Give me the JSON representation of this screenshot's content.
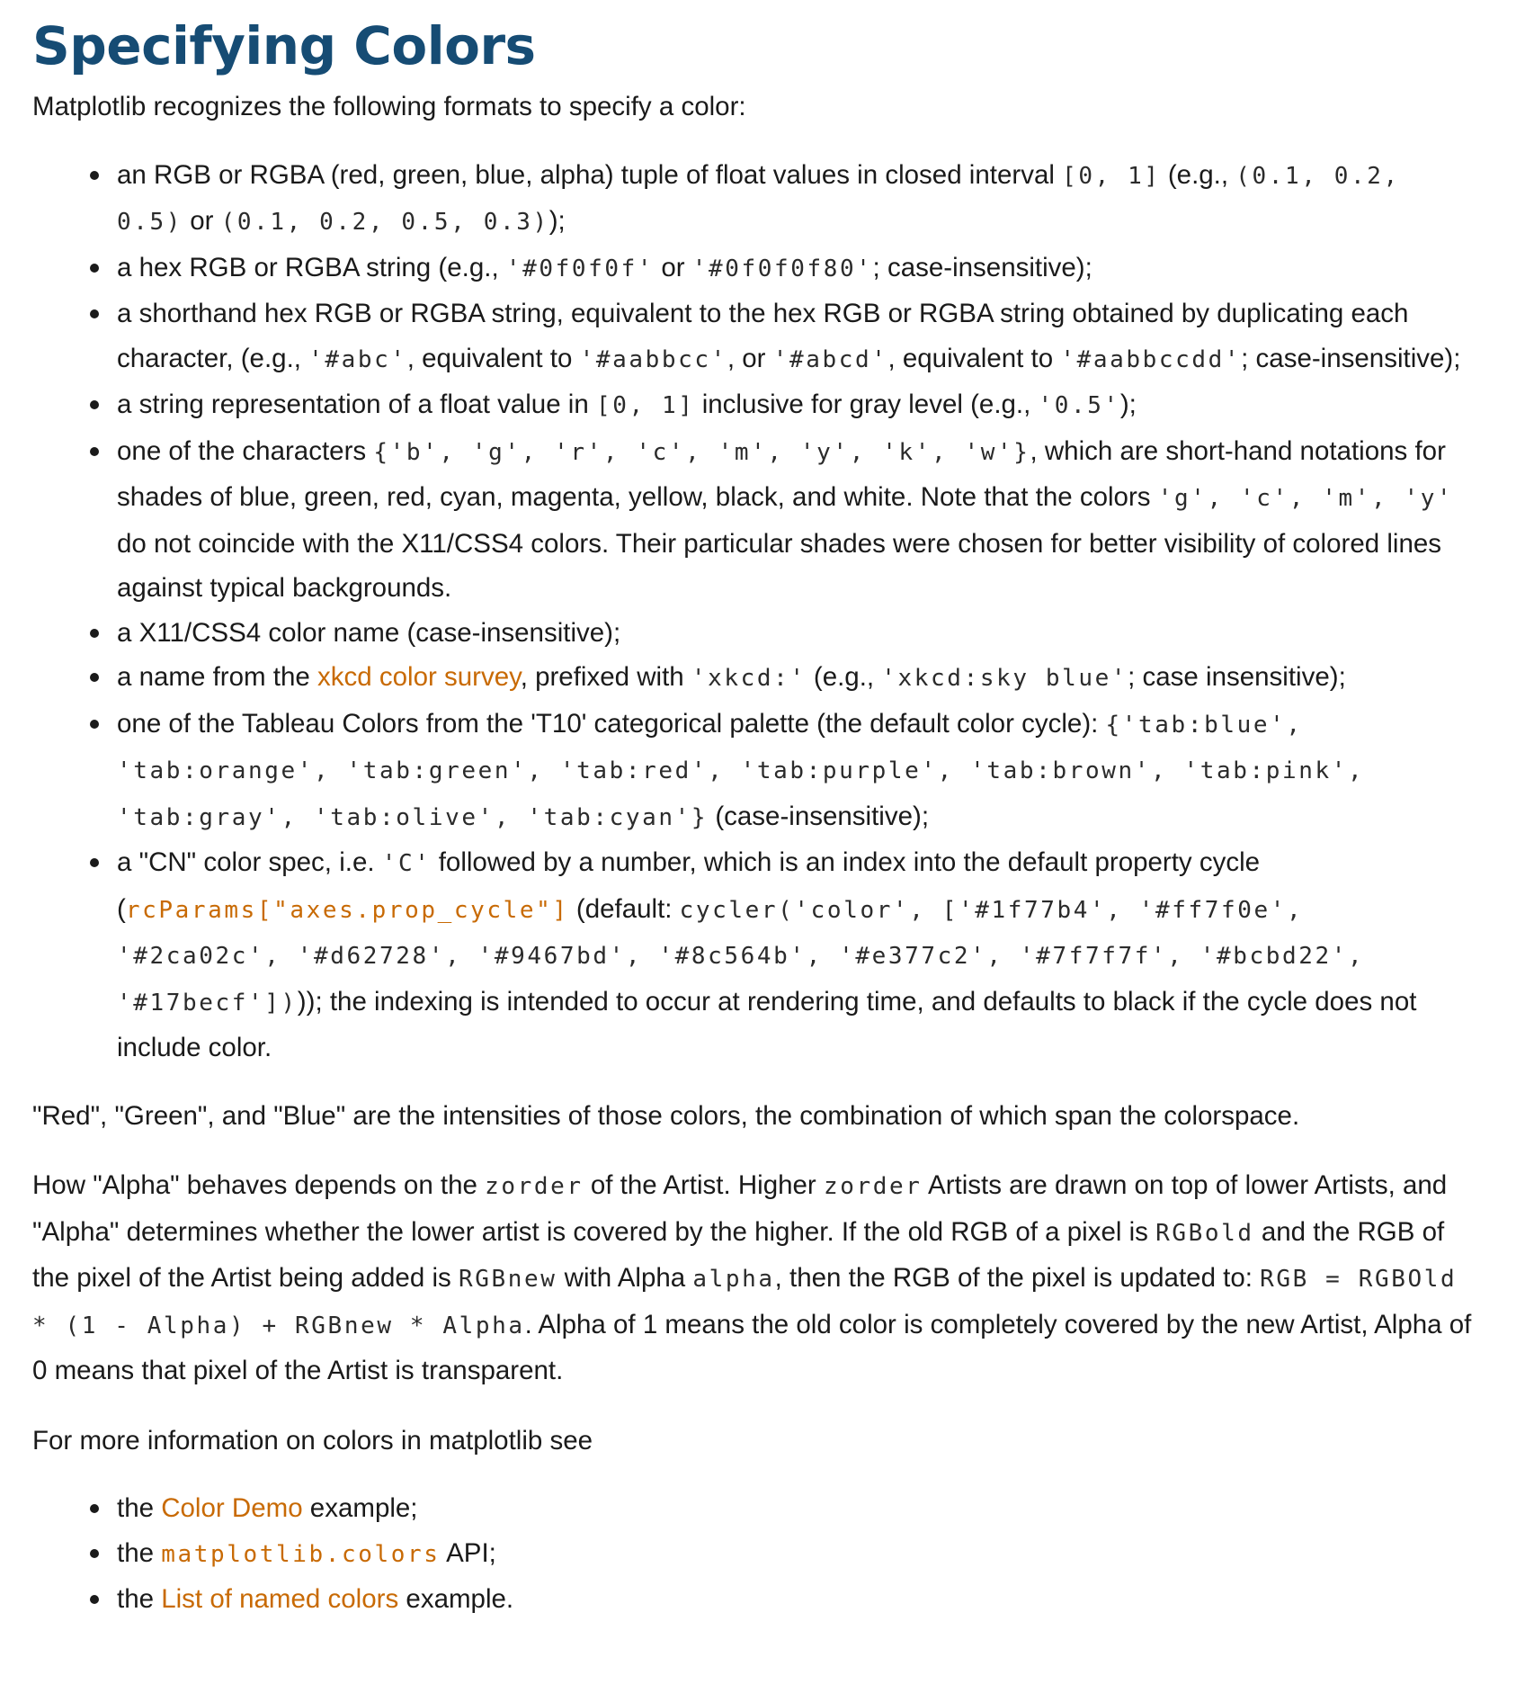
{
  "title": "Specifying Colors",
  "intro": "Matplotlib recognizes the following formats to specify a color:",
  "formats": {
    "rgb": {
      "t1": "an RGB or RGBA (red, green, blue, alpha) tuple of float values in closed interval ",
      "c1": "[0, 1]",
      "t2": " (e.g., ",
      "c2": "(0.1, 0.2, 0.5)",
      "t3": " or ",
      "c3": "(0.1, 0.2, 0.5, 0.3)",
      "t4": ");"
    },
    "hex": {
      "t1": "a hex RGB or RGBA string (e.g., ",
      "c1": "'#0f0f0f'",
      "t2": " or ",
      "c2": "'#0f0f0f80'",
      "t3": "; case-insensitive);"
    },
    "shorthand": {
      "t1": "a shorthand hex RGB or RGBA string, equivalent to the hex RGB or RGBA string obtained by duplicating each character, (e.g., ",
      "c1": "'#abc'",
      "t2": ", equivalent to ",
      "c2": "'#aabbcc'",
      "t3": ", or ",
      "c3": "'#abcd'",
      "t4": ", equivalent to ",
      "c4": "'#aabbccdd'",
      "t5": "; case-insensitive);"
    },
    "gray": {
      "t1": "a string representation of a float value in ",
      "c1": "[0, 1]",
      "t2": " inclusive for gray level (e.g., ",
      "c2": "'0.5'",
      "t3": ");"
    },
    "chars": {
      "t1": "one of the characters ",
      "c1": "{'b', 'g', 'r', 'c', 'm', 'y', 'k', 'w'}",
      "t2": ", which are short-hand notations for shades of blue, green, red, cyan, magenta, yellow, black, and white. Note that the colors ",
      "c2": "'g', 'c', 'm', 'y'",
      "t3": " do not coincide with the X11/CSS4 colors. Their particular shades were chosen for better visibility of colored lines against typical backgrounds."
    },
    "x11": {
      "t1": "a X11/CSS4 color name (case-insensitive);"
    },
    "xkcd": {
      "t1": "a name from the ",
      "link": "xkcd color survey",
      "t2": ", prefixed with ",
      "c1": "'xkcd:'",
      "t3": " (e.g., ",
      "c2": "'xkcd:sky blue'",
      "t4": "; case insensitive);"
    },
    "tableau": {
      "t1": "one of the Tableau Colors from the 'T10' categorical palette (the default color cycle): ",
      "c1": "{'tab:blue', 'tab:orange', 'tab:green', 'tab:red', 'tab:purple', 'tab:brown', 'tab:pink', 'tab:gray', 'tab:olive', 'tab:cyan'}",
      "t2": " (case-insensitive);"
    },
    "cn": {
      "t1": "a \"CN\" color spec, i.e. ",
      "c1": "'C'",
      "t2": " followed by a number, which is an index into the default property cycle (",
      "link_code": "rcParams[\"axes.prop_cycle\"]",
      "t3": " (default: ",
      "c2": "cycler('color', ['#1f77b4', '#ff7f0e', '#2ca02c', '#d62728', '#9467bd', '#8c564b', '#e377c2', '#7f7f7f', '#bcbd22', '#17becf'])",
      "t4": ")); the indexing is intended to occur at rendering time, and defaults to black if the cycle does not include color."
    }
  },
  "rgb_paragraph": "\"Red\", \"Green\", and \"Blue\" are the intensities of those colors, the combination of which span the colorspace.",
  "alpha_paragraph": {
    "t1": "How \"Alpha\" behaves depends on the ",
    "c1": "zorder",
    "t2": " of the Artist. Higher ",
    "c2": "zorder",
    "t3": " Artists are drawn on top of lower Artists, and \"Alpha\" determines whether the lower artist is covered by the higher. If the old RGB of a pixel is ",
    "c3": "RGBold",
    "t4": " and the RGB of the pixel of the Artist being added is ",
    "c4": "RGBnew",
    "t5": " with Alpha ",
    "c5": "alpha",
    "t6": ", then the RGB of the pixel is updated to: ",
    "c6": "RGB = RGBOld * (1 - Alpha) + RGBnew * Alpha",
    "t7": ". Alpha of 1 means the old color is completely covered by the new Artist, Alpha of 0 means that pixel of the Artist is transparent."
  },
  "more_info": "For more information on colors in matplotlib see",
  "see_also": {
    "demo": {
      "t1": "the ",
      "link": "Color Demo",
      "t2": " example;"
    },
    "api": {
      "t1": "the ",
      "link_code": "matplotlib.colors",
      "t2": " API;"
    },
    "named": {
      "t1": "the ",
      "link": "List of named colors",
      "t2": " example."
    }
  },
  "colors": {
    "heading": "#164c74",
    "link": "#c86a04",
    "text": "#1a1a1a"
  }
}
